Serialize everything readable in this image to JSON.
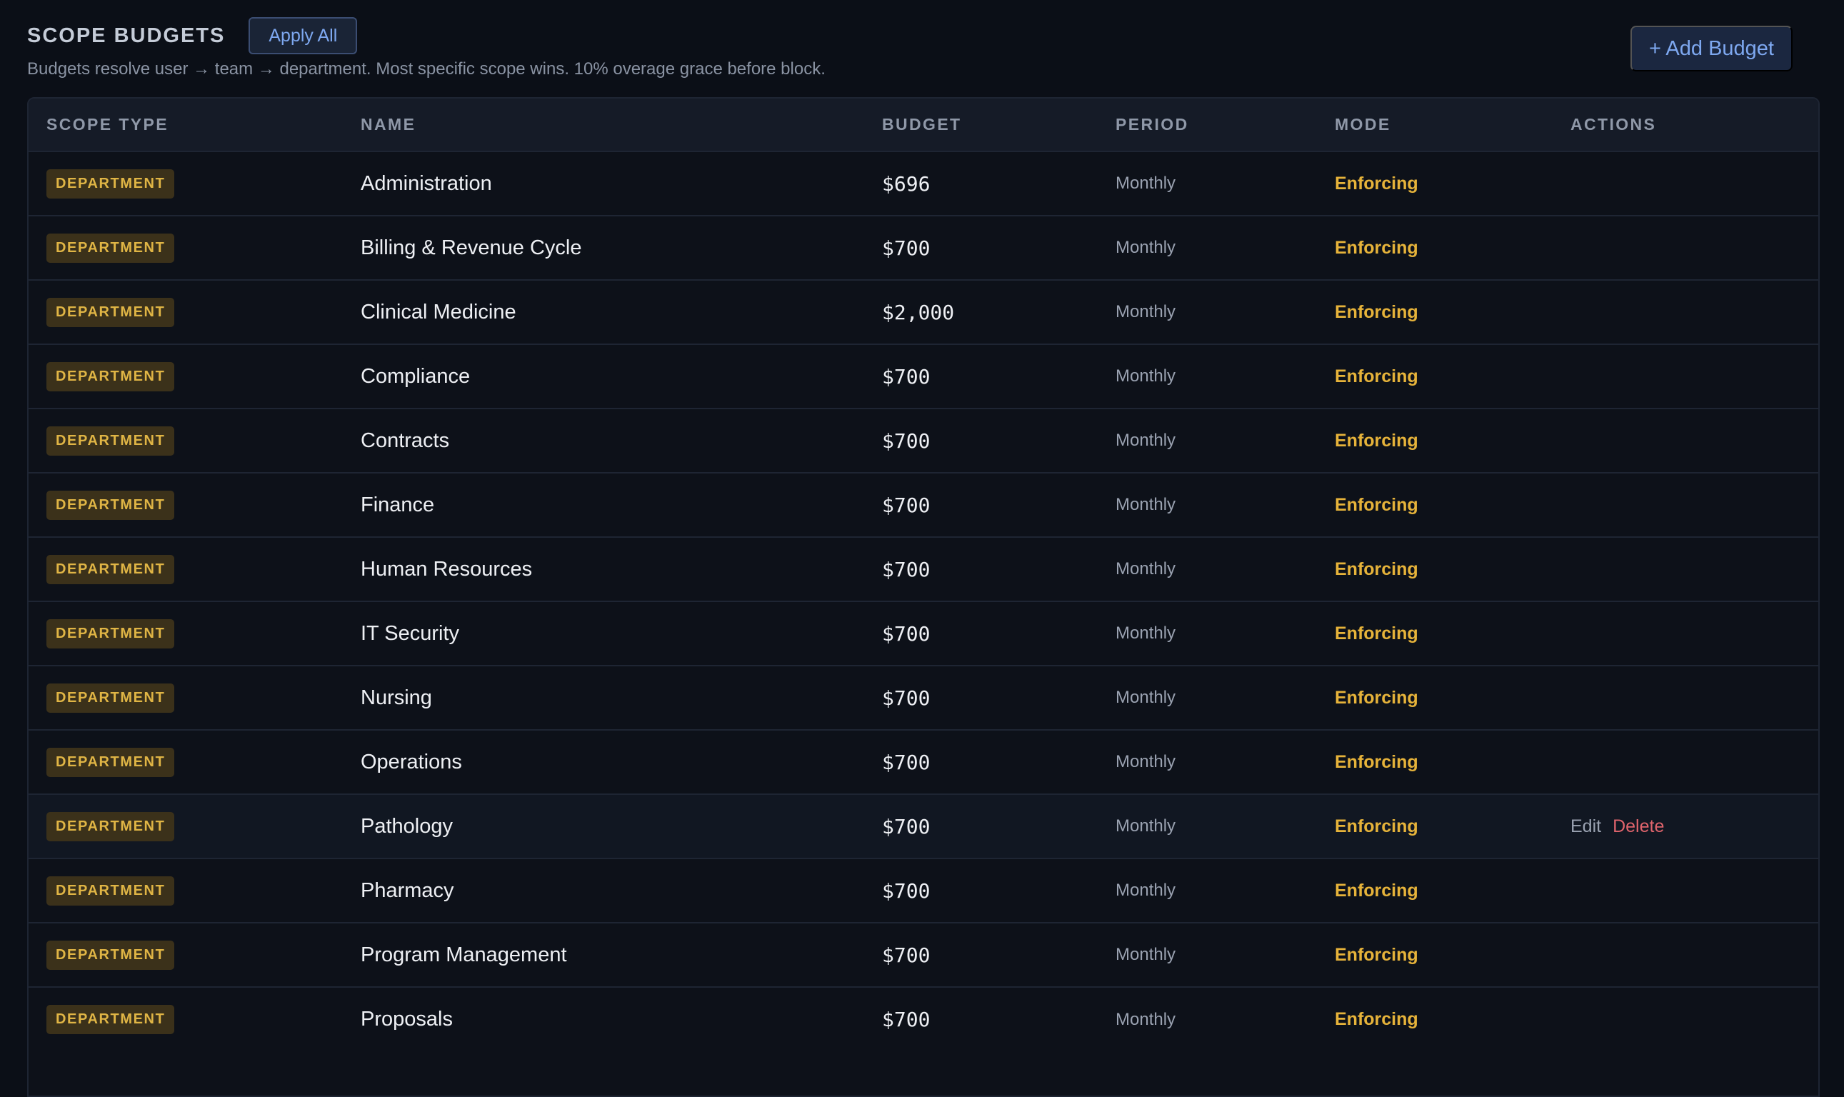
{
  "header": {
    "title": "SCOPE BUDGETS",
    "apply_all": "Apply All",
    "subtitle": "Budgets resolve user → team → department. Most specific scope wins. 10% overage grace before block.",
    "add_budget": "+ Add Budget"
  },
  "table": {
    "columns": {
      "scope_type": "SCOPE TYPE",
      "name": "NAME",
      "budget": "BUDGET",
      "period": "PERIOD",
      "mode": "MODE",
      "actions": "ACTIONS"
    },
    "rows": [
      {
        "scope": "DEPARTMENT",
        "name": "Administration",
        "budget": "$696",
        "period": "Monthly",
        "mode": "Enforcing"
      },
      {
        "scope": "DEPARTMENT",
        "name": "Billing & Revenue Cycle",
        "budget": "$700",
        "period": "Monthly",
        "mode": "Enforcing"
      },
      {
        "scope": "DEPARTMENT",
        "name": "Clinical Medicine",
        "budget": "$2,000",
        "period": "Monthly",
        "mode": "Enforcing"
      },
      {
        "scope": "DEPARTMENT",
        "name": "Compliance",
        "budget": "$700",
        "period": "Monthly",
        "mode": "Enforcing"
      },
      {
        "scope": "DEPARTMENT",
        "name": "Contracts",
        "budget": "$700",
        "period": "Monthly",
        "mode": "Enforcing"
      },
      {
        "scope": "DEPARTMENT",
        "name": "Finance",
        "budget": "$700",
        "period": "Monthly",
        "mode": "Enforcing"
      },
      {
        "scope": "DEPARTMENT",
        "name": "Human Resources",
        "budget": "$700",
        "period": "Monthly",
        "mode": "Enforcing"
      },
      {
        "scope": "DEPARTMENT",
        "name": "IT Security",
        "budget": "$700",
        "period": "Monthly",
        "mode": "Enforcing"
      },
      {
        "scope": "DEPARTMENT",
        "name": "Nursing",
        "budget": "$700",
        "period": "Monthly",
        "mode": "Enforcing"
      },
      {
        "scope": "DEPARTMENT",
        "name": "Operations",
        "budget": "$700",
        "period": "Monthly",
        "mode": "Enforcing"
      },
      {
        "scope": "DEPARTMENT",
        "name": "Pathology",
        "budget": "$700",
        "period": "Monthly",
        "mode": "Enforcing",
        "edit": "Edit",
        "delete": "Delete"
      },
      {
        "scope": "DEPARTMENT",
        "name": "Pharmacy",
        "budget": "$700",
        "period": "Monthly",
        "mode": "Enforcing"
      },
      {
        "scope": "DEPARTMENT",
        "name": "Program Management",
        "budget": "$700",
        "period": "Monthly",
        "mode": "Enforcing"
      },
      {
        "scope": "DEPARTMENT",
        "name": "Proposals",
        "budget": "$700",
        "period": "Monthly",
        "mode": "Enforcing"
      }
    ]
  },
  "colors": {
    "background": "#0b0f17",
    "accent_blue": "#7ea8f0",
    "enforcing": "#e6b33a",
    "badge_bg": "#3b311a",
    "delete": "#e0646c"
  }
}
